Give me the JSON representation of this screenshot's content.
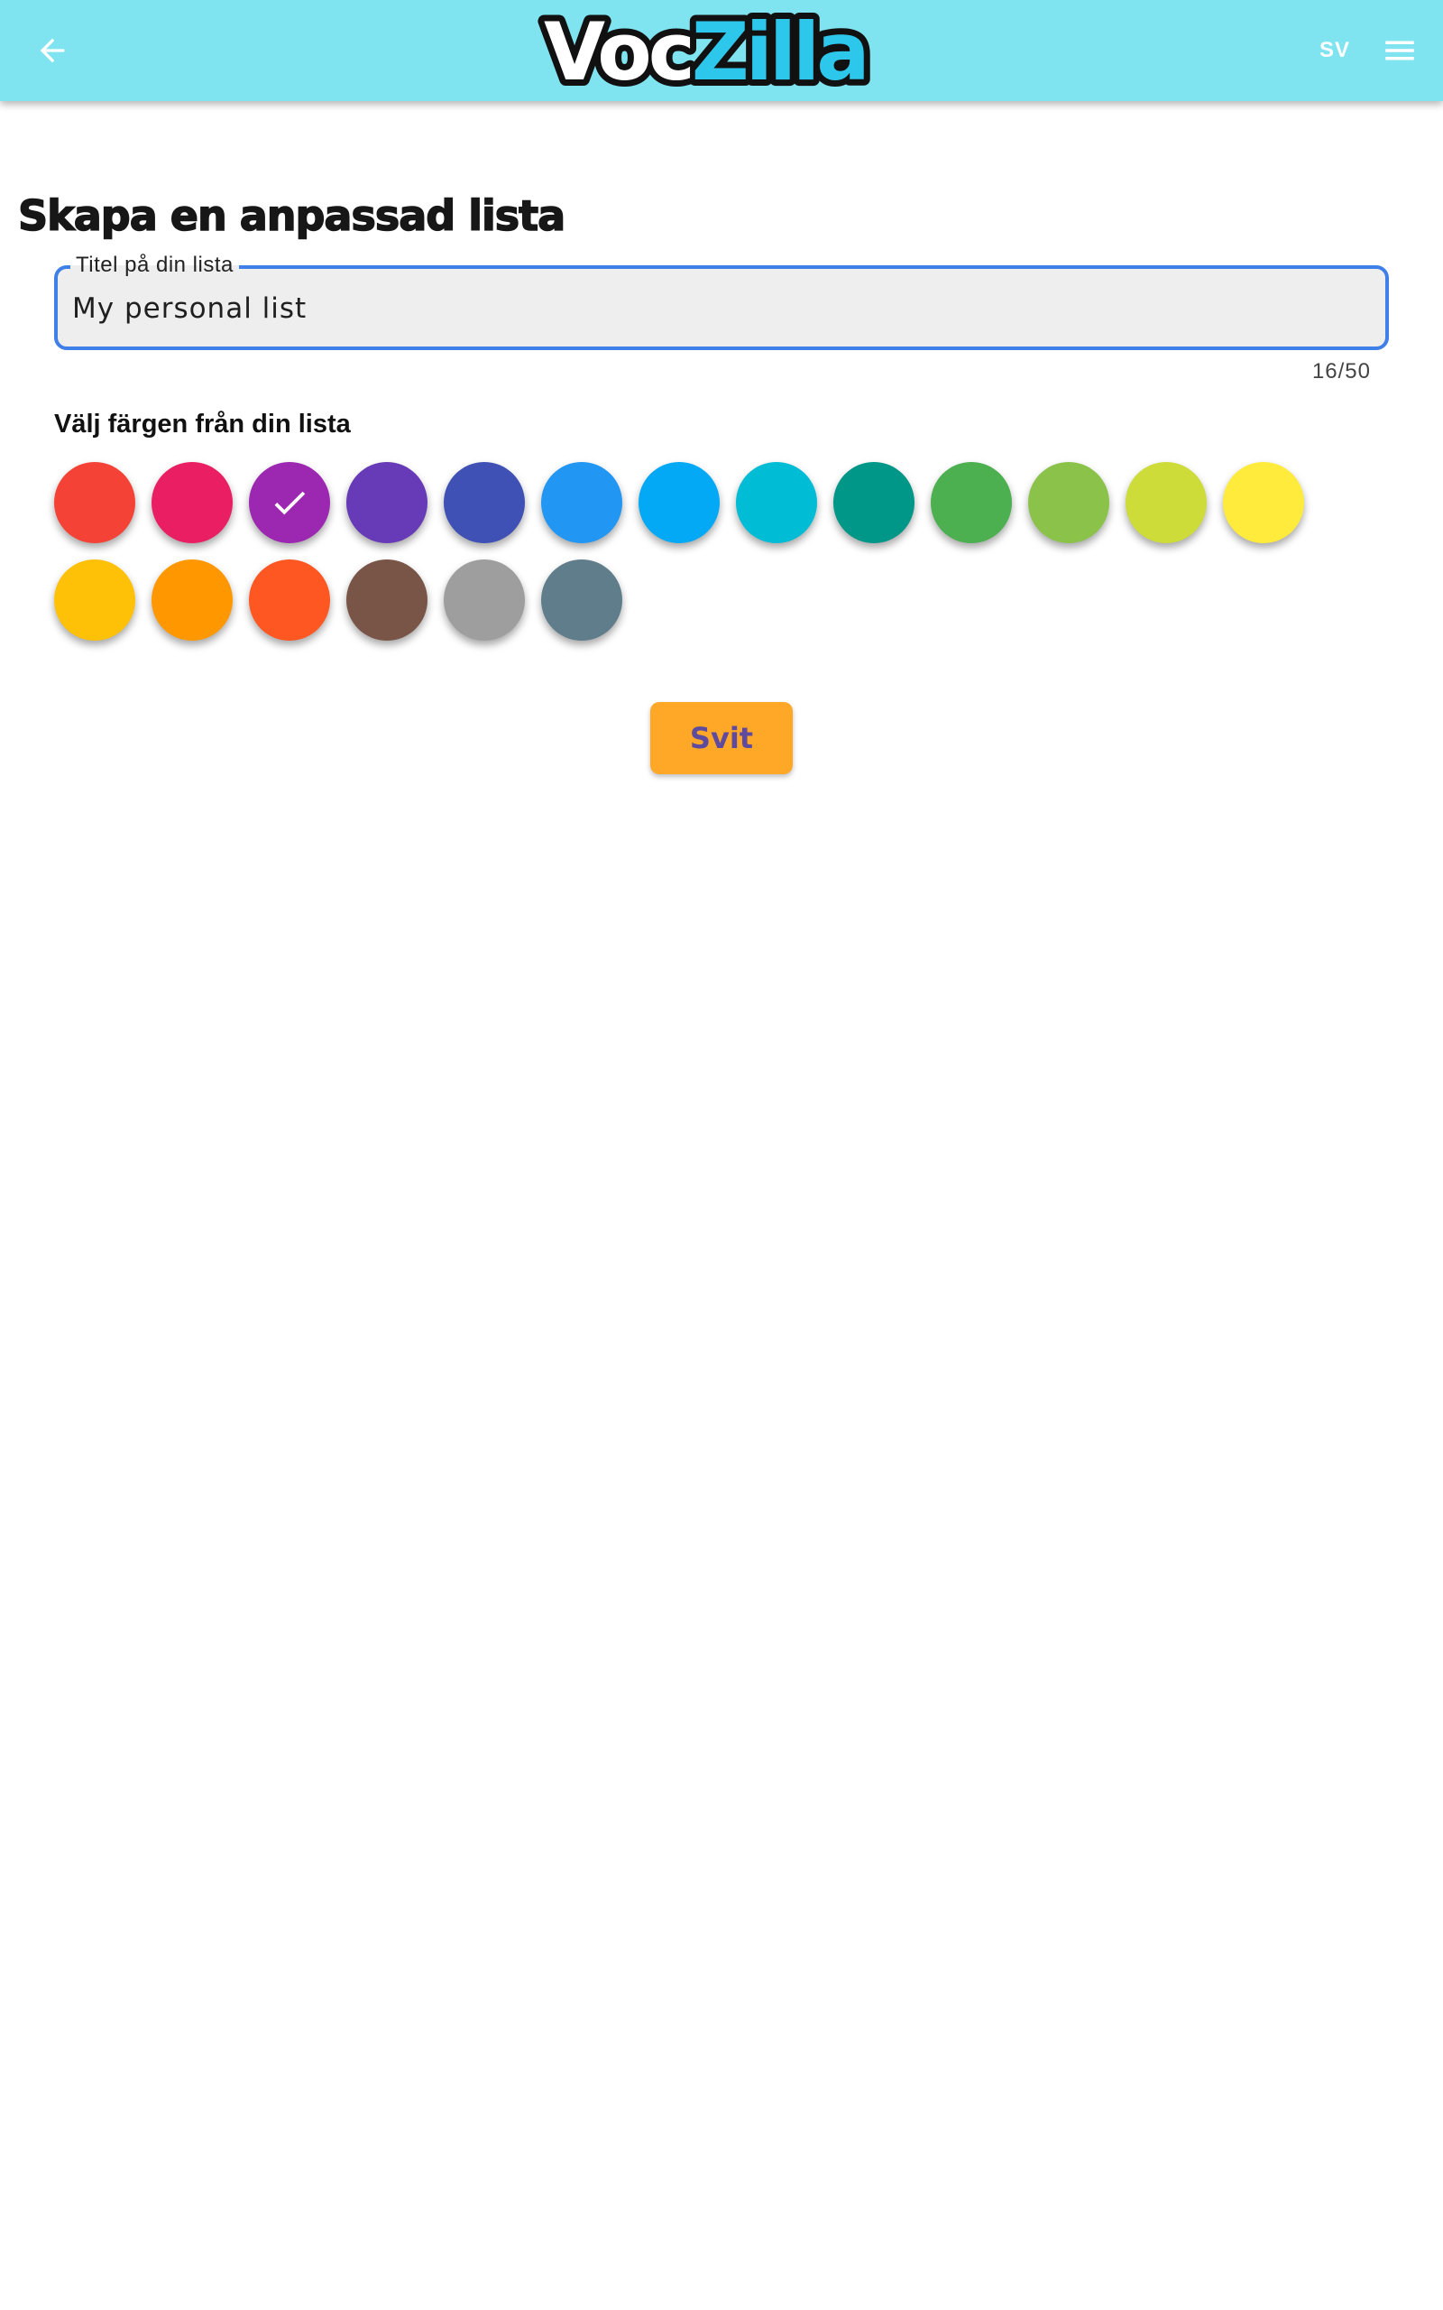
{
  "header": {
    "logo_part1": "Voc",
    "logo_part2": "Zilla",
    "language": "SV",
    "background_color": "#7fe3f0"
  },
  "page": {
    "title": "Skapa en anpassad lista"
  },
  "title_field": {
    "label": "Titel på din lista",
    "value": "My personal list",
    "counter": "16/50"
  },
  "color_picker": {
    "heading": "Välj färgen från din lista",
    "selected_index": 2,
    "colors": [
      "#f44336",
      "#e91e63",
      "#9c27b0",
      "#673ab7",
      "#3f51b5",
      "#2196f3",
      "#03a9f4",
      "#00bcd4",
      "#009688",
      "#4caf50",
      "#8bc34a",
      "#cddc39",
      "#ffeb3b",
      "#ffc107",
      "#ff9800",
      "#ff5722",
      "#795548",
      "#9e9e9e",
      "#607d8b"
    ]
  },
  "actions": {
    "submit_label": "Svit"
  }
}
